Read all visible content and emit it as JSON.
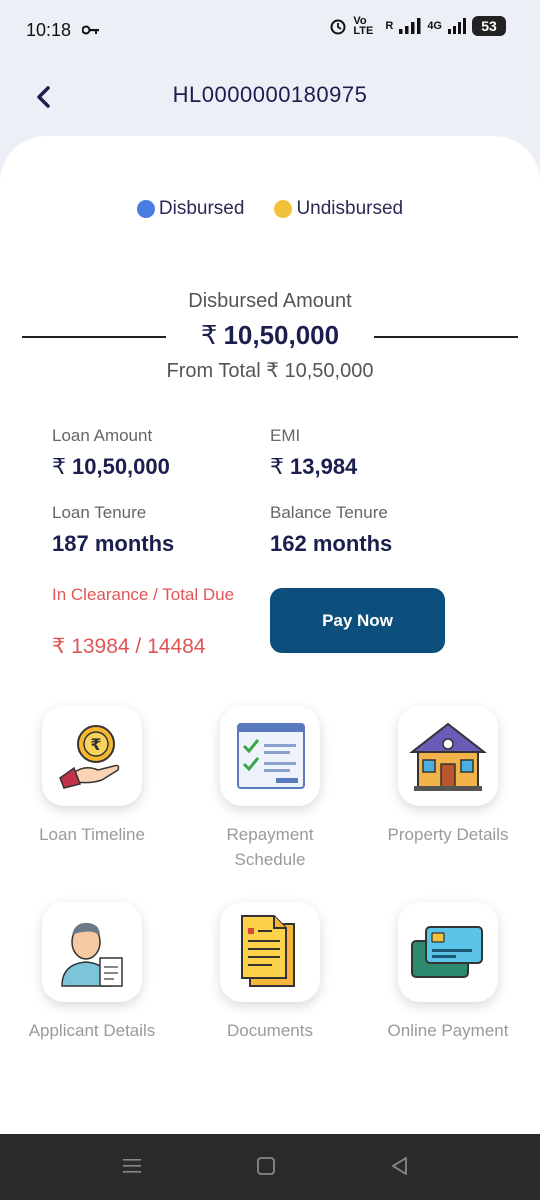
{
  "status": {
    "time": "10:18",
    "network": "Vo LTE",
    "signal_r": "R",
    "net_type": "4G",
    "battery": "53"
  },
  "header": {
    "loan_id": "HL0000000180975"
  },
  "legend": [
    {
      "label": "Disbursed",
      "color": "#4a7be0"
    },
    {
      "label": "Undisbursed",
      "color": "#f0c13a"
    }
  ],
  "disbursed": {
    "label": "Disbursed Amount",
    "currency": "₹",
    "amount": "10,50,000",
    "from_total": "From Total ₹ 10,50,000"
  },
  "details": {
    "loan_amount_label": "Loan Amount",
    "loan_amount_value": "10,50,000",
    "emi_label": "EMI",
    "emi_value": "13,984",
    "loan_tenure_label": "Loan Tenure",
    "loan_tenure_value": "187 months",
    "balance_tenure_label": "Balance Tenure",
    "balance_tenure_value": "162 months",
    "due_label": "In Clearance / Total Due",
    "due_value": "₹ 13984 / 14484",
    "currency": "₹"
  },
  "pay_button": "Pay Now",
  "tiles": [
    {
      "label": "Loan Timeline",
      "icon": "coin-hand-icon"
    },
    {
      "label": "Repayment Schedule",
      "icon": "checklist-icon"
    },
    {
      "label": "Property Details",
      "icon": "house-icon"
    },
    {
      "label": "Applicant Details",
      "icon": "person-document-icon"
    },
    {
      "label": "Documents",
      "icon": "documents-icon"
    },
    {
      "label": "Online Payment",
      "icon": "cards-icon"
    }
  ]
}
